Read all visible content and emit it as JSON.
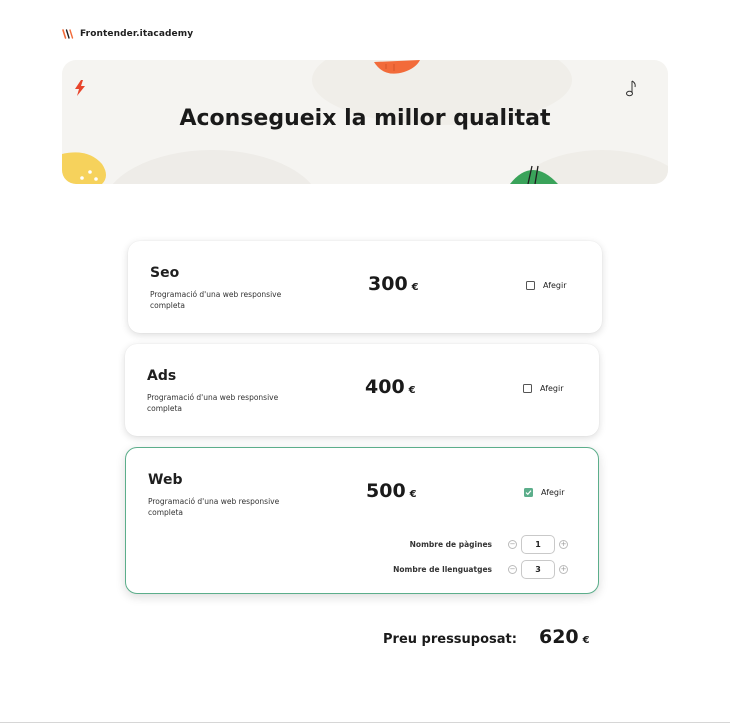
{
  "header": {
    "brand": "Frontender.itacademy",
    "logo_icon": "brand-logo-icon"
  },
  "hero": {
    "title": "Aconsegueix la millor qualitat"
  },
  "currency": "€",
  "services": [
    {
      "title": "Seo",
      "description": "Programació d'una web responsive completa",
      "price": "300",
      "add_label": "Afegir",
      "checked": false
    },
    {
      "title": "Ads",
      "description": "Programació d'una web responsive completa",
      "price": "400",
      "add_label": "Afegir",
      "checked": false
    },
    {
      "title": "Web",
      "description": "Programació d'una web responsive completa",
      "price": "500",
      "add_label": "Afegir",
      "checked": true
    }
  ],
  "web_options": {
    "pages_label": "Nombre de pàgines",
    "pages_value": "1",
    "languages_label": "Nombre de llenguatges",
    "languages_value": "3",
    "minus_symbol": "−",
    "plus_symbol": "+"
  },
  "summary": {
    "label": "Preu pressuposat:",
    "value": "620"
  },
  "colors": {
    "accent": "#5cae8b",
    "hero_bg": "#f5f4f1",
    "orange": "#f26b3a",
    "yellow": "#f6d25c",
    "green": "#3aa35a",
    "red": "#e8452c"
  }
}
